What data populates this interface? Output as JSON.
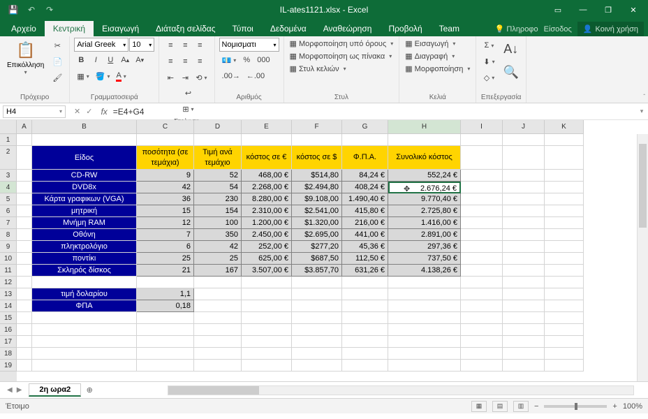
{
  "titlebar": {
    "filename": "IL-ates1121.xlsx - Excel"
  },
  "tabs": {
    "file": "Αρχείο",
    "home": "Κεντρική",
    "insert": "Εισαγωγή",
    "pagelayout": "Διάταξη σελίδας",
    "formulas": "Τύποι",
    "data": "Δεδομένα",
    "review": "Αναθεώρηση",
    "view": "Προβολή",
    "team": "Team",
    "tellme": "Πληροφο",
    "signin": "Είσοδος",
    "share": "Κοινή χρήση"
  },
  "ribbon": {
    "clipboard": {
      "label": "Πρόχειρο",
      "paste": "Επικόλληση"
    },
    "font": {
      "label": "Γραμματοσειρά",
      "name": "Arial Greek",
      "size": "10",
      "bold": "B",
      "italic": "I",
      "underline": "U"
    },
    "alignment": {
      "label": "Στοίχιση"
    },
    "number": {
      "label": "Αριθμός",
      "format": "Νομισματι",
      "percent": "%",
      "comma": "000"
    },
    "styles": {
      "label": "Στυλ",
      "cond": "Μορφοποίηση υπό όρους",
      "table": "Μορφοποίηση ως πίνακα",
      "cell": "Στυλ κελιών"
    },
    "cells": {
      "label": "Κελιά",
      "insert": "Εισαγωγή",
      "delete": "Διαγραφή",
      "format": "Μορφοποίηση"
    },
    "editing": {
      "label": "Επεξεργασία"
    }
  },
  "namebox": "H4",
  "formula": "=E4+G4",
  "columns": [
    "A",
    "B",
    "C",
    "D",
    "E",
    "F",
    "G",
    "H",
    "I",
    "J",
    "K"
  ],
  "rows": [
    "1",
    "2",
    "3",
    "4",
    "5",
    "6",
    "7",
    "8",
    "9",
    "10",
    "11",
    "12",
    "13",
    "14",
    "15",
    "16",
    "17",
    "18",
    "19"
  ],
  "headers": {
    "B": "Είδος",
    "C": "ποσότητα (σε τεμάχια)",
    "D": "Τιμή ανά τεμάχιο",
    "E": "κόστος σε €",
    "F": "κόστος σε $",
    "G": "Φ.Π.Α.",
    "H": "Συνολικό κόστος"
  },
  "data": [
    {
      "B": "CD-RW",
      "C": "9",
      "D": "52",
      "E": "468,00 €",
      "F": "$514,80",
      "G": "84,24 €",
      "H": "552,24 €"
    },
    {
      "B": "DVD8x",
      "C": "42",
      "D": "54",
      "E": "2.268,00 €",
      "F": "$2.494,80",
      "G": "408,24 €",
      "H": "2.676,24 €"
    },
    {
      "B": "Κάρτα γραφικων (VGA)",
      "C": "36",
      "D": "230",
      "E": "8.280,00 €",
      "F": "$9.108,00",
      "G": "1.490,40 €",
      "H": "9.770,40 €"
    },
    {
      "B": "μητρική",
      "C": "15",
      "D": "154",
      "E": "2.310,00 €",
      "F": "$2.541,00",
      "G": "415,80 €",
      "H": "2.725,80 €"
    },
    {
      "B": "Μνήμη RAM",
      "C": "12",
      "D": "100",
      "E": "1.200,00 €",
      "F": "$1.320,00",
      "G": "216,00 €",
      "H": "1.416,00 €"
    },
    {
      "B": "Οθόνη",
      "C": "7",
      "D": "350",
      "E": "2.450,00 €",
      "F": "$2.695,00",
      "G": "441,00 €",
      "H": "2.891,00 €"
    },
    {
      "B": "πληκτρολόγιο",
      "C": "6",
      "D": "42",
      "E": "252,00 €",
      "F": "$277,20",
      "G": "45,36 €",
      "H": "297,36 €"
    },
    {
      "B": "ποντίκι",
      "C": "25",
      "D": "25",
      "E": "625,00 €",
      "F": "$687,50",
      "G": "112,50 €",
      "H": "737,50 €"
    },
    {
      "B": "Σκληρός δίσκος",
      "C": "21",
      "D": "167",
      "E": "3.507,00 €",
      "F": "$3.857,70",
      "G": "631,26 €",
      "H": "4.138,26 €"
    }
  ],
  "footer": [
    {
      "B": "τιμή δολαρίου",
      "C": "1,1"
    },
    {
      "B": "ΦΠΑ",
      "C": "0,18"
    }
  ],
  "sheettab": "2η ωρα2",
  "status": {
    "ready": "Έτοιμο",
    "zoom": "100%"
  }
}
